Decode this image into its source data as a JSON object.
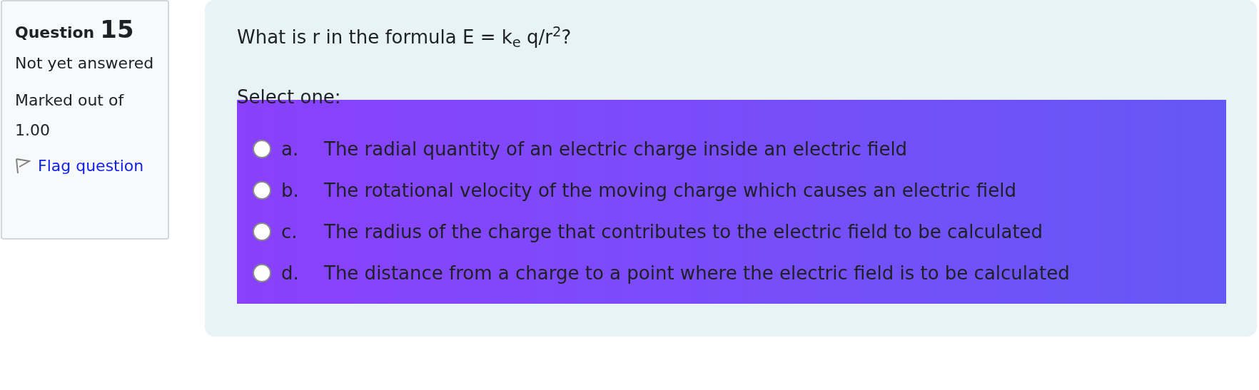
{
  "info": {
    "label": "Question",
    "number": "15",
    "state": "Not yet answered",
    "marks": "Marked out of 1.00",
    "flag": "Flag question"
  },
  "question": {
    "text": "What is r in the formula E = k$_{e}$ q/r$^{2}$?",
    "prompt": "Select one:",
    "options": [
      {
        "letter": "a.",
        "text": "The radial quantity of an electric charge inside an electric field",
        "selected": false
      },
      {
        "letter": "b.",
        "text": "The rotational velocity of the moving charge which causes an electric field",
        "selected": false
      },
      {
        "letter": "c.",
        "text": "The radius of the charge that contributes to the electric field to be calculated",
        "selected": false
      },
      {
        "letter": "d.",
        "text": "The distance from a charge to a point where the electric field is to be calculated",
        "selected": false
      }
    ]
  }
}
